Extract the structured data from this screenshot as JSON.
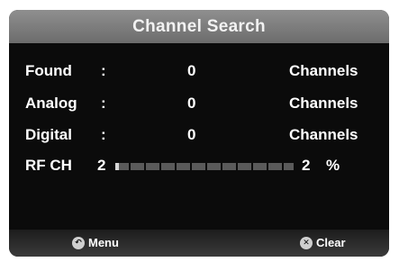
{
  "title": "Channel Search",
  "rows": [
    {
      "label": "Found",
      "colon": ":",
      "value": "0",
      "unit": "Channels"
    },
    {
      "label": "Analog",
      "colon": ":",
      "value": "0",
      "unit": "Channels"
    },
    {
      "label": "Digital",
      "colon": ":",
      "value": "0",
      "unit": "Channels"
    }
  ],
  "rf": {
    "label": "RF CH",
    "channel": "2",
    "percent_value": "2",
    "percent_sign": "%",
    "progress_fraction": 0.02
  },
  "footer": {
    "menu_label": "Menu",
    "clear_label": "Clear",
    "menu_icon": "back-arrow-icon",
    "clear_icon": "x-icon"
  }
}
